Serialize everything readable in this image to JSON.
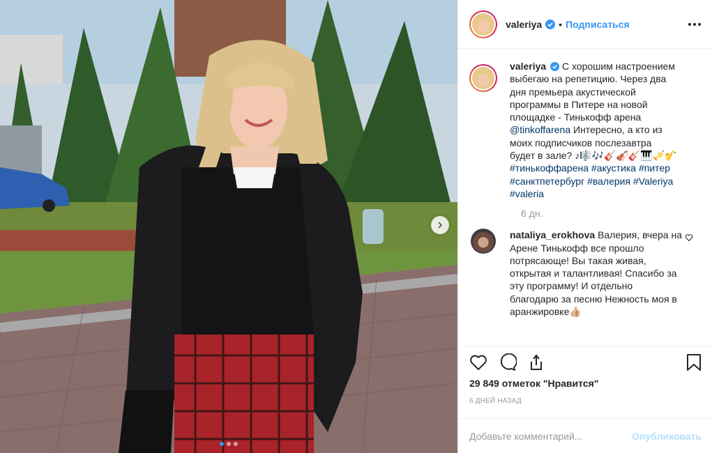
{
  "post": {
    "username": "valeriya",
    "follow_label": "Подписаться",
    "separator": "•",
    "caption": {
      "username": "valeriya",
      "text_part1": "С хорошим настроением выбегаю на репетицию. Через два дня премьера акустической программы в Питере на новой площадке - Тинькофф арена",
      "mention": "@tinkoffarena",
      "text_part2": "Интересно, а кто из моих подписчиков послезавтра будет в зале?",
      "emoji": "♪🎼🎶🎸🎻🎸🎹🎺🎷",
      "hashtags": "#тинькоффарена #акустика #питер #санктпетербург #валерия #Valeriya #valeria",
      "time_ago": "6 дн."
    },
    "comments": [
      {
        "username": "nataliya_erokhova",
        "text": "Валерия, вчера на Арене Тинькофф все прошло потрясающе! Вы такая живая, открытая и талантливая! Спасибо за эту программу! И отдельно благодарю за песню Нежность моя в аранжировке👍🏼"
      }
    ],
    "likes_text": "29 849 отметок \"Нравится\"",
    "posted_ago": "6 ДНЕЙ НАЗАД",
    "add_comment_placeholder": "Добавьте комментарий...",
    "publish_label": "Опубликовать",
    "carousel": {
      "total": 3,
      "active_index": 0
    }
  },
  "colors": {
    "accent": "#3897f0",
    "link": "#003569",
    "muted": "#999999",
    "publish_disabled": "#b2dffc"
  },
  "icons": [
    "verified-badge-icon",
    "more-options-icon",
    "heart-icon",
    "comment-icon",
    "share-icon",
    "bookmark-icon",
    "chevron-right-icon"
  ]
}
